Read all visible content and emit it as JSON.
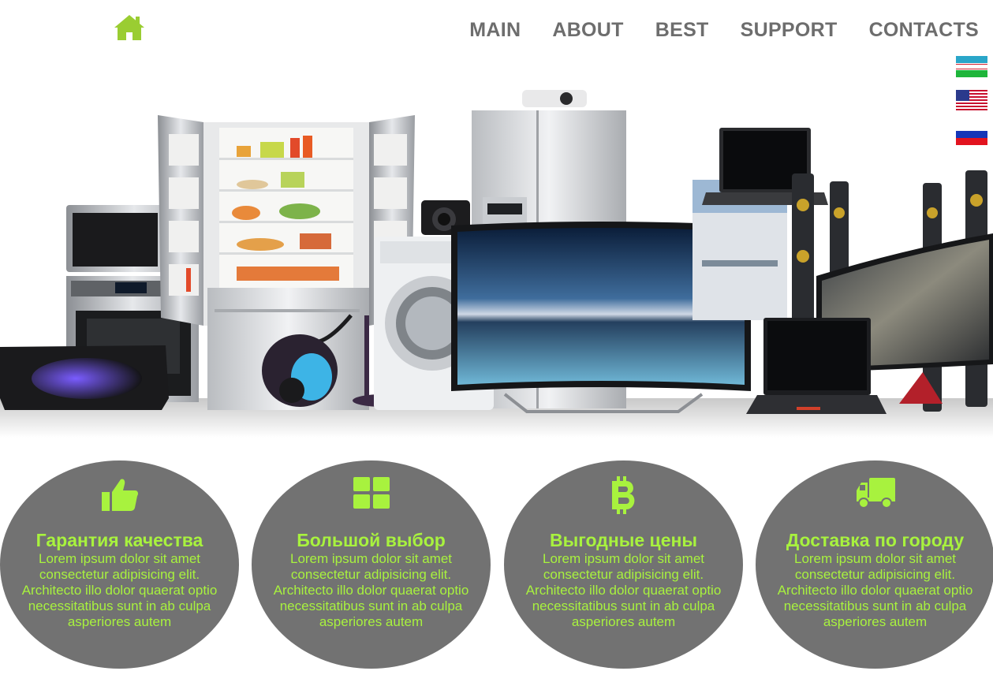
{
  "colors": {
    "accent": "#a8f23e",
    "nav_text": "#6d6d6d",
    "feature_bg": "#727272"
  },
  "header": {
    "home_icon": "home-icon",
    "nav": [
      "MAIN",
      "ABOUT",
      "BEST",
      "SUPPORT",
      "CONTACTS"
    ]
  },
  "languages": [
    {
      "flag": "uzbekistan-flag-icon"
    },
    {
      "flag": "usa-flag-icon"
    },
    {
      "flag": "russia-flag-icon"
    }
  ],
  "features": [
    {
      "icon": "thumbs-up-icon",
      "title": "Гарантия качества",
      "text": "Lorem ipsum dolor sit amet consectetur adipisicing elit. Architecto illo dolor quaerat optio necessitatibus sunt in ab culpa asperiores autem"
    },
    {
      "icon": "grid-icon",
      "title": "Большой выбор",
      "text": "Lorem ipsum dolor sit amet consectetur adipisicing elit. Architecto illo dolor quaerat optio necessitatibus sunt in ab culpa asperiores autem"
    },
    {
      "icon": "bitcoin-icon",
      "title": "Выгодные цены",
      "text": "Lorem ipsum dolor sit amet consectetur adipisicing elit. Architecto illo dolor quaerat optio necessitatibus sunt in ab culpa asperiores autem"
    },
    {
      "icon": "truck-icon",
      "title": "Доставка по городу",
      "text": "Lorem ipsum dolor sit amet consectetur adipisicing elit. Architecto illo dolor quaerat optio necessitatibus sunt in ab culpa asperiores autem"
    }
  ]
}
